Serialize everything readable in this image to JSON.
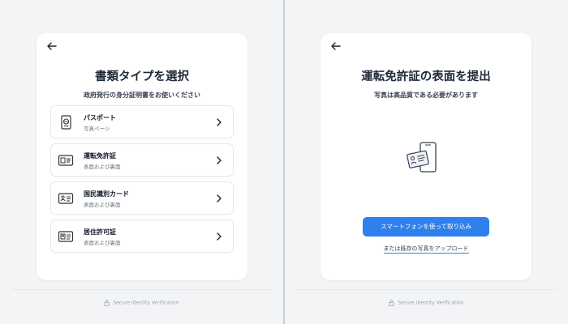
{
  "left": {
    "back_icon": "arrow-left-icon",
    "title": "書類タイプを選択",
    "subtitle": "政府発行の身分証明書をお使いください",
    "options": [
      {
        "label": "パスポート",
        "sub": "写真ページ",
        "icon": "passport-icon"
      },
      {
        "label": "運転免許証",
        "sub": "表面および裏面",
        "icon": "drivers-license-icon"
      },
      {
        "label": "国民識別カード",
        "sub": "表面および裏面",
        "icon": "id-card-icon"
      },
      {
        "label": "居住許可証",
        "sub": "表面および裏面",
        "icon": "residence-permit-icon"
      }
    ],
    "footer": "Secure Identity Verification"
  },
  "right": {
    "back_icon": "arrow-left-icon",
    "title": "運転免許証の表面を提出",
    "subtitle": "写真は高品質である必要があります",
    "illustration_icon": "phone-id-scan-icon",
    "primary_button": "スマートフォンを使って取り込み",
    "upload_link": "または既存の写真をアップロード",
    "footer": "Secure Identity Verification"
  },
  "colors": {
    "accent": "#2f80ed",
    "background": "#f3f4f6",
    "card": "#ffffff"
  }
}
